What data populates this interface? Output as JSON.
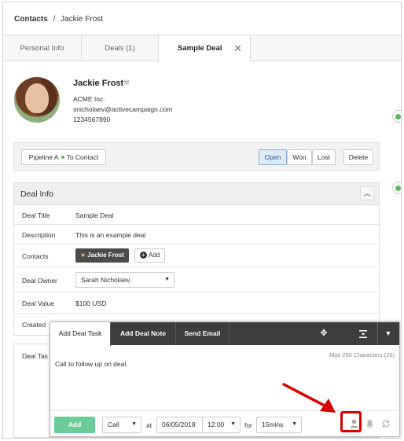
{
  "breadcrumb": {
    "root": "Contacts",
    "separator": "/",
    "current": "Jackie Frost"
  },
  "tabs": [
    {
      "label": "Personal Info"
    },
    {
      "label": "Deals (1)"
    },
    {
      "label": "Sample Deal",
      "close": "✕"
    }
  ],
  "contact": {
    "name": "Jackie Frost",
    "company": "ACME Inc.",
    "email": "snicholaev@activecampaign.com",
    "phone": "1234567890"
  },
  "stage_bar": {
    "pipeline": "Pipeline A",
    "stage": "To Contact",
    "status_buttons": [
      "Open",
      "Won",
      "Lost"
    ],
    "active_status": "Open",
    "delete_label": "Delete"
  },
  "deal_info": {
    "title": "Deal Info",
    "rows": {
      "deal_title": {
        "label": "Deal Title",
        "value": "Sample Deal"
      },
      "description": {
        "label": "Description",
        "value": "This is an example deal"
      },
      "contacts": {
        "label": "Contacts",
        "chip": "Jackie Frost",
        "add_label": "Add"
      },
      "deal_owner": {
        "label": "Deal Owner",
        "value": "Sarah Nicholaev"
      },
      "deal_value": {
        "label": "Deal Value",
        "value": "$100 USD"
      },
      "created": {
        "label": "Created"
      }
    }
  },
  "lower_panel": {
    "label": "Deal Tas"
  },
  "task_popup": {
    "tabs": [
      "Add Deal Task",
      "Add Deal Note",
      "Send Email"
    ],
    "active_tab": "Add Deal Task",
    "max_chars": "Max 250 Characters (26)",
    "task_text": "Call to follow up on deal.",
    "add_label": "Add",
    "type": "Call",
    "at_label": "at",
    "date": "06/05/2018",
    "time": "12:00",
    "for_label": "for",
    "duration": "15mins"
  },
  "colors": {
    "add_green": "#6bcb99",
    "dark_bar": "#3d3d3d",
    "highlight_red": "#d60000",
    "open_active": "#dde9f5",
    "status_dot": "#5cb85c"
  },
  "icons": [
    "gear-icon",
    "close-icon",
    "chevron-up-icon",
    "star-icon",
    "plus-icon",
    "move-icon",
    "minimize-icon",
    "chevron-down-icon",
    "user-icon",
    "bell-icon",
    "repeat-icon",
    "arrow-annotation"
  ]
}
